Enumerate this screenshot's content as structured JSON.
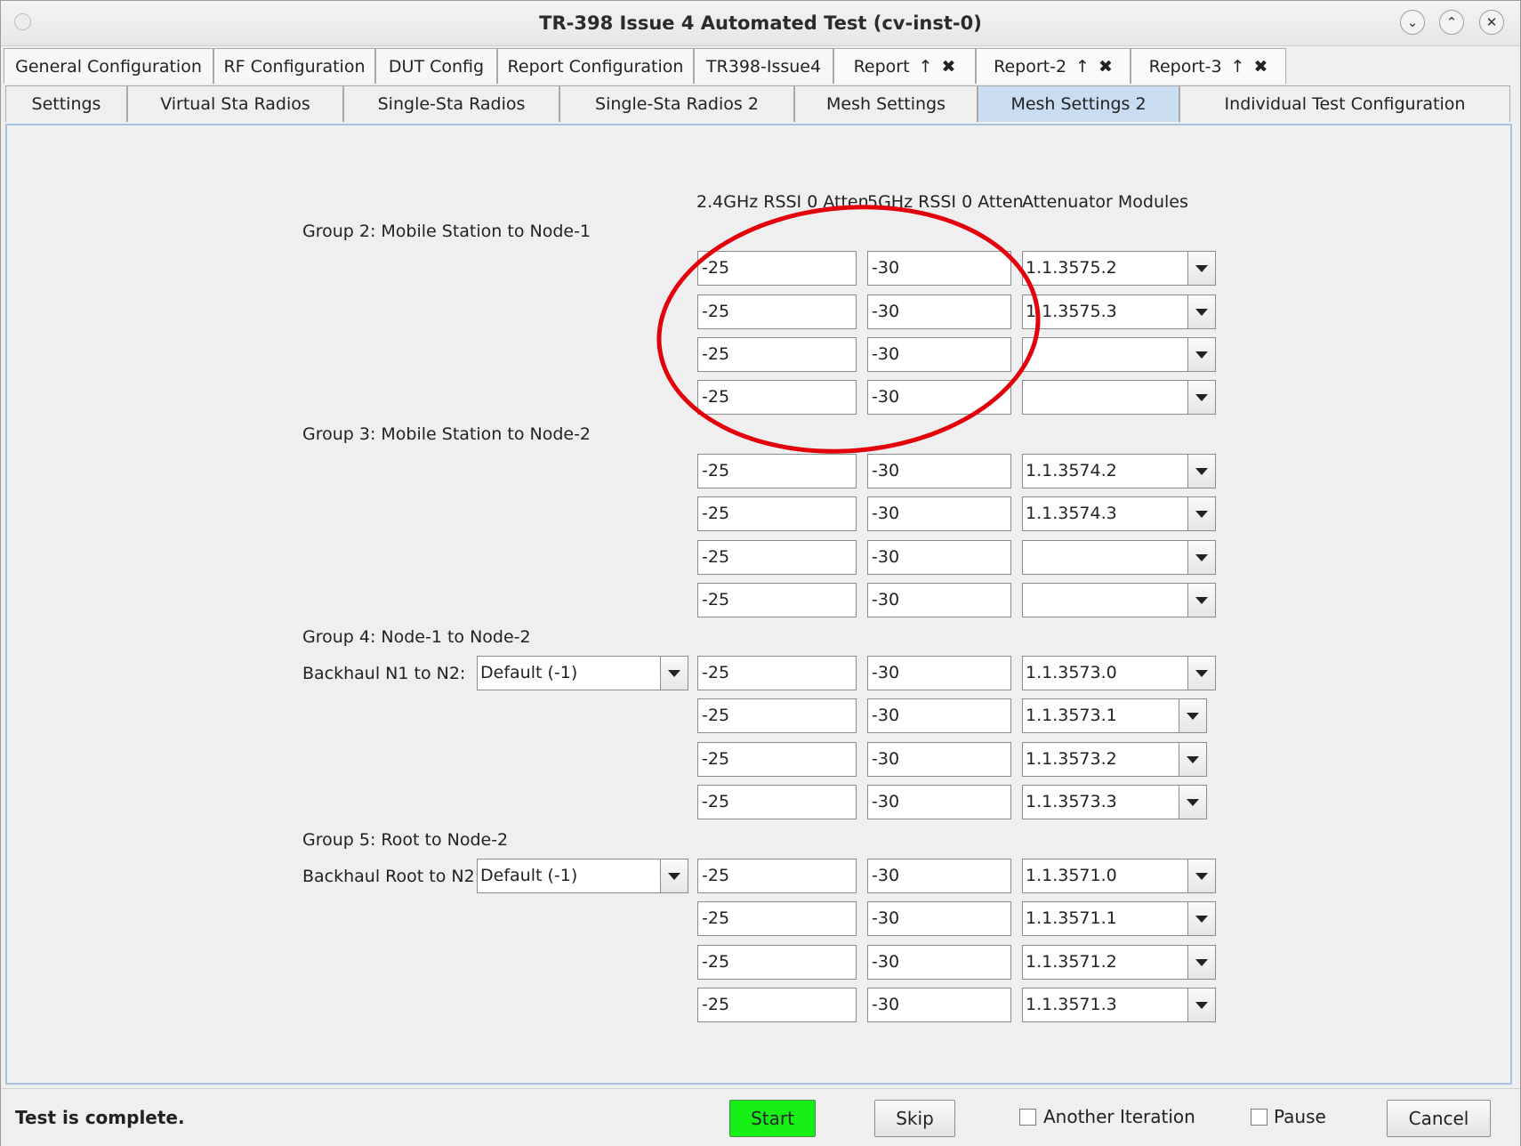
{
  "window": {
    "title": "TR-398 Issue 4 Automated Test  (cv-inst-0)",
    "min_glyph": "⌄",
    "max_glyph": "⌃",
    "close_glyph": "✕"
  },
  "tabs_row1": [
    {
      "label": "General Configuration"
    },
    {
      "label": "RF Configuration"
    },
    {
      "label": "DUT Config"
    },
    {
      "label": "Report Configuration"
    },
    {
      "label": "TR398-Issue4"
    },
    {
      "label": "Report",
      "pin": "↑",
      "close": "✖"
    },
    {
      "label": "Report-2",
      "pin": "↑",
      "close": "✖"
    },
    {
      "label": "Report-3",
      "pin": "↑",
      "close": "✖"
    }
  ],
  "tabs_row2": [
    {
      "label": "Settings"
    },
    {
      "label": "Virtual Sta Radios"
    },
    {
      "label": "Single-Sta Radios"
    },
    {
      "label": "Single-Sta Radios 2"
    },
    {
      "label": "Mesh Settings"
    },
    {
      "label": "Mesh Settings 2",
      "active": true
    },
    {
      "label": "Individual Test Configuration"
    }
  ],
  "columns": {
    "rssi24": "2.4GHz RSSI 0 Atten",
    "rssi5": "5GHz RSSI 0 Atten",
    "modules": "Attenuator Modules"
  },
  "groups": [
    {
      "label": "Group 2: Mobile Station to Node-1",
      "rows": [
        {
          "rssi24": "-25",
          "rssi5": "-30",
          "module": "1.1.3575.2"
        },
        {
          "rssi24": "-25",
          "rssi5": "-30",
          "module": "1.1.3575.3"
        },
        {
          "rssi24": "-25",
          "rssi5": "-30",
          "module": ""
        },
        {
          "rssi24": "-25",
          "rssi5": "-30",
          "module": ""
        }
      ]
    },
    {
      "label": "Group 3: Mobile Station to Node-2",
      "rows": [
        {
          "rssi24": "-25",
          "rssi5": "-30",
          "module": "1.1.3574.2"
        },
        {
          "rssi24": "-25",
          "rssi5": "-30",
          "module": "1.1.3574.3"
        },
        {
          "rssi24": "-25",
          "rssi5": "-30",
          "module": ""
        },
        {
          "rssi24": "-25",
          "rssi5": "-30",
          "module": ""
        }
      ]
    },
    {
      "label": "Group 4: Node-1 to Node-2",
      "backhaul_label": "Backhaul N1 to N2:",
      "backhaul_value": "Default (-1)",
      "rows": [
        {
          "rssi24": "-25",
          "rssi5": "-30",
          "module": "1.1.3573.0"
        },
        {
          "rssi24": "-25",
          "rssi5": "-30",
          "module": "1.1.3573.1"
        },
        {
          "rssi24": "-25",
          "rssi5": "-30",
          "module": "1.1.3573.2"
        },
        {
          "rssi24": "-25",
          "rssi5": "-30",
          "module": "1.1.3573.3"
        }
      ]
    },
    {
      "label": "Group 5: Root to Node-2",
      "backhaul_label": "Backhaul Root to N2:",
      "backhaul_value": "Default (-1)",
      "rows": [
        {
          "rssi24": "-25",
          "rssi5": "-30",
          "module": "1.1.3571.0"
        },
        {
          "rssi24": "-25",
          "rssi5": "-30",
          "module": "1.1.3571.1"
        },
        {
          "rssi24": "-25",
          "rssi5": "-30",
          "module": "1.1.3571.2"
        },
        {
          "rssi24": "-25",
          "rssi5": "-30",
          "module": "1.1.3571.3"
        }
      ]
    }
  ],
  "status": {
    "text": "Test is complete.",
    "start_label": "Start",
    "skip_label": "Skip",
    "another_iteration_label": "Another Iteration",
    "another_iteration_checked": false,
    "pause_label": "Pause",
    "pause_checked": false,
    "cancel_label": "Cancel"
  },
  "colors": {
    "active_tab": "#c9dcf0",
    "start_button": "#16f016",
    "highlight_ring": "#e3000b"
  }
}
